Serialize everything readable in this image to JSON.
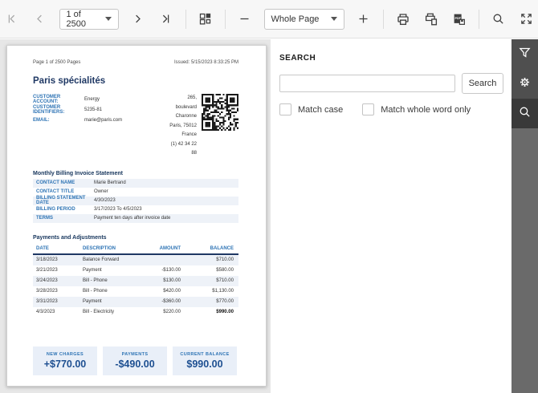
{
  "toolbar": {
    "page_selector_value": "1 of 2500",
    "zoom_selector_value": "Whole Page",
    "icons": [
      "first-page",
      "previous-page",
      "next-page",
      "last-page",
      "thumbnails",
      "zoom-out",
      "zoom-in",
      "print",
      "print-all",
      "export-pdf",
      "search",
      "fullscreen"
    ]
  },
  "search_panel": {
    "title": "SEARCH",
    "input_value": "",
    "input_placeholder": "",
    "search_button_label": "Search",
    "match_case_label": "Match case",
    "match_whole_word_label": "Match whole word only"
  },
  "sidebar": {
    "icons": [
      "filter",
      "settings",
      "search"
    ],
    "active": "search"
  },
  "document": {
    "page_info": "Page 1 of 2500 Pages",
    "issued": "Issued: 5/15/2023 8:33:25 PM",
    "title": "Paris spécialités",
    "customer_fields": [
      {
        "label": "CUSTOMER ACCOUNT:",
        "value": "Energy"
      },
      {
        "label": "CUSTOMER IDENTIFIERS:",
        "value": "5235-81"
      },
      {
        "label": "EMAIL:",
        "value": "marie@paris.com"
      }
    ],
    "address_lines": [
      "265, boulevard Charonne",
      "Paris,  75012",
      "France",
      "(1) 42 34 22 88"
    ],
    "statement": {
      "heading": "Monthly Billing Invoice Statement",
      "rows": [
        {
          "label": "CONTACT NAME",
          "value": "Marie Bertrand"
        },
        {
          "label": "CONTACT TITLE",
          "value": "Owner"
        },
        {
          "label": "BILLING STATEMENT DATE",
          "value": "4/30/2023"
        },
        {
          "label": "BILLING PERIOD",
          "value": "3/17/2023 To 4/5/2023"
        },
        {
          "label": "TERMS",
          "value": "Payment ten days after invoice date"
        }
      ]
    },
    "payments": {
      "heading": "Payments and Adjustments",
      "columns": [
        "DATE",
        "DESCRIPTION",
        "AMOUNT",
        "BALANCE"
      ],
      "rows": [
        [
          "3/18/2023",
          "Balance Forward",
          "",
          "$710.00"
        ],
        [
          "3/21/2023",
          "Payment",
          "-$130.00",
          "$580.00"
        ],
        [
          "3/24/2023",
          "Bill - Phone",
          "$130.00",
          "$710.00"
        ],
        [
          "3/28/2023",
          "Bill - Phone",
          "$420.00",
          "$1,130.00"
        ],
        [
          "3/31/2023",
          "Payment",
          "-$360.00",
          "$770.00"
        ],
        [
          "4/3/2023",
          "Bill - Electricity",
          "$220.00",
          "$990.00"
        ]
      ]
    },
    "summary": [
      {
        "label": "NEW CHARGES",
        "value": "+$770.00"
      },
      {
        "label": "PAYMENTS",
        "value": "-$490.00"
      },
      {
        "label": "CURRENT BALANCE",
        "value": "$990.00"
      }
    ]
  },
  "colors": {
    "accent_blue": "#2e74b5",
    "heading_navy": "#17365d",
    "value_blue": "#1d4f91",
    "toolbar_bg": "#f7f7f7",
    "viewer_bg": "#e7e7e7",
    "rail_bg": "#4f4f4f",
    "rail_active_bg": "#393939",
    "row_alt_bg": "#eef2f8",
    "summary_bg": "#e9eff8"
  }
}
